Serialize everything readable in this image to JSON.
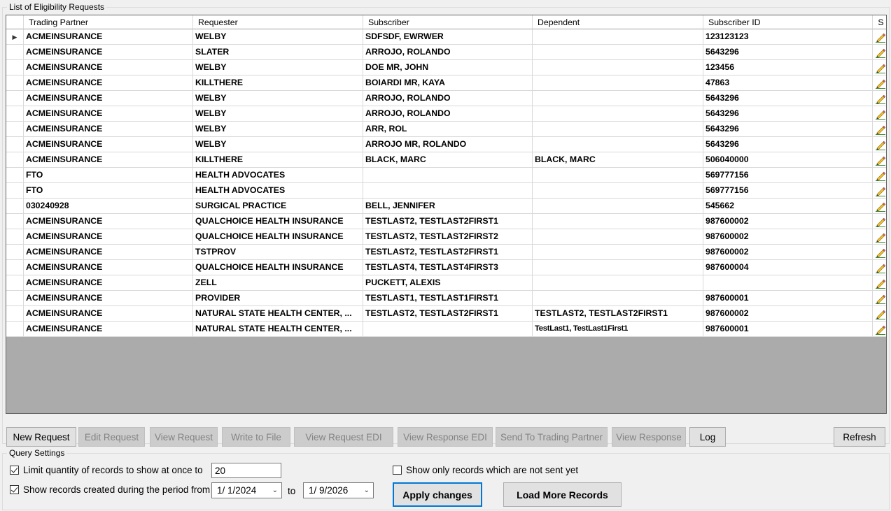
{
  "grid_group": {
    "title": "List of Eligibility Requests"
  },
  "grid": {
    "columns": [
      "",
      "Trading Partner",
      "Requester",
      "Subscriber",
      "Dependent",
      "Subscriber ID",
      "S"
    ],
    "rows": [
      [
        "ACMEINSURANCE",
        "WELBY",
        "SDFSDF, EWRWER",
        "",
        "123123123"
      ],
      [
        "ACMEINSURANCE",
        "SLATER",
        "ARROJO, ROLANDO",
        "",
        "5643296"
      ],
      [
        "ACMEINSURANCE",
        "WELBY",
        "DOE MR, JOHN",
        "",
        "123456"
      ],
      [
        "ACMEINSURANCE",
        "KILLTHERE",
        "BOIARDI MR, KAYA",
        "",
        "47863"
      ],
      [
        "ACMEINSURANCE",
        "WELBY",
        "ARROJO, ROLANDO",
        "",
        "5643296"
      ],
      [
        "ACMEINSURANCE",
        "WELBY",
        "ARROJO, ROLANDO",
        "",
        "5643296"
      ],
      [
        "ACMEINSURANCE",
        "WELBY",
        "ARR, ROL",
        "",
        "5643296"
      ],
      [
        "ACMEINSURANCE",
        "WELBY",
        "ARROJO MR, ROLANDO",
        "",
        "5643296"
      ],
      [
        "ACMEINSURANCE",
        "KILLTHERE",
        "BLACK, MARC",
        "BLACK, MARC",
        "506040000"
      ],
      [
        "FTO",
        "HEALTH ADVOCATES",
        "",
        "",
        "569777156"
      ],
      [
        "FTO",
        "HEALTH ADVOCATES",
        "",
        "",
        "569777156"
      ],
      [
        "030240928",
        "SURGICAL PRACTICE",
        "BELL, JENNIFER",
        "",
        "545662"
      ],
      [
        "ACMEINSURANCE",
        "QUALCHOICE HEALTH INSURANCE",
        "TESTLAST2, TESTLAST2FIRST1",
        "",
        "987600002"
      ],
      [
        "ACMEINSURANCE",
        "QUALCHOICE HEALTH INSURANCE",
        "TESTLAST2, TESTLAST2FIRST2",
        "",
        "987600002"
      ],
      [
        "ACMEINSURANCE",
        "TSTPROV",
        "TESTLAST2, TESTLAST2FIRST1",
        "",
        "987600002"
      ],
      [
        "ACMEINSURANCE",
        "QUALCHOICE HEALTH INSURANCE",
        "TESTLAST4, TESTLAST4FIRST3",
        "",
        "987600004"
      ],
      [
        "ACMEINSURANCE",
        "ZELL",
        "PUCKETT, ALEXIS",
        "",
        ""
      ],
      [
        "ACMEINSURANCE",
        "PROVIDER",
        "TESTLAST1, TESTLAST1FIRST1",
        "",
        "987600001"
      ],
      [
        "ACMEINSURANCE",
        "NATURAL STATE HEALTH CENTER, ...",
        "TESTLAST2, TESTLAST2FIRST1",
        "TESTLAST2, TESTLAST2FIRST1",
        "987600002"
      ],
      [
        "ACMEINSURANCE",
        "NATURAL STATE HEALTH CENTER, ...",
        "",
        "TestLast1, TestLast1First1",
        "987600001"
      ]
    ],
    "current_row_marker": "▶",
    "edit_icon": "pencil-icon"
  },
  "buttons": {
    "new_request": "New Request",
    "edit_request": "Edit Request",
    "view_request": "View Request",
    "write_to_file": "Write to File",
    "view_request_edi": "View Request EDI",
    "view_response_edi": "View Response EDI",
    "send_to_trading_partner": "Send To Trading Partner",
    "view_response": "View Response",
    "log": "Log",
    "refresh": "Refresh"
  },
  "query_settings": {
    "title": "Query Settings",
    "limit_label": "Limit quantity of records to show at once to",
    "limit_value": "20",
    "limit_checked": true,
    "period_label": "Show records created during the period from",
    "period_checked": true,
    "date_from": "1/  1/2024",
    "to_label": "to",
    "date_to": "1/  9/2026",
    "not_sent_label": "Show only records which are not sent yet",
    "not_sent_checked": false,
    "apply_label": "Apply changes",
    "load_more_label": "Load More Records"
  },
  "colors": {
    "grid_empty_area": "#ababab",
    "focus_border": "#0078d7",
    "disabled_button": "#cccccc"
  }
}
